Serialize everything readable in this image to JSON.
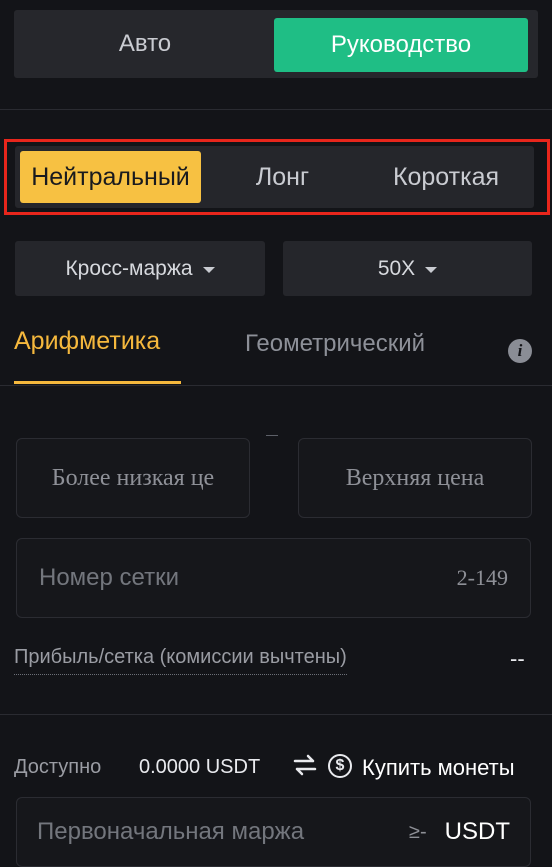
{
  "mode": {
    "auto": "Авто",
    "manual": "Руководство"
  },
  "direction": {
    "neutral": "Нейтральный",
    "long": "Лонг",
    "short": "Короткая"
  },
  "margin_mode": {
    "label": "Кросс-маржа"
  },
  "leverage": {
    "label": "50X"
  },
  "tabs": {
    "arithmetic": "Арифметика",
    "geometric": "Геометрический",
    "info_icon": "i"
  },
  "price": {
    "lower_placeholder": "Более низкая це",
    "upper_placeholder": "Верхняя цена"
  },
  "grid": {
    "placeholder": "Номер сетки",
    "range": "2-149"
  },
  "profit": {
    "label": "Прибыль/сетка (комиссии вычтены)",
    "value": "--"
  },
  "available": {
    "label": "Доступно",
    "value": "0.0000 USDT",
    "buy_coins": "Купить монеты"
  },
  "initial_margin": {
    "placeholder": "Первоначальная маржа",
    "min_prefix": "≥-",
    "unit": "USDT"
  },
  "colors": {
    "accent_green": "#1fbe85",
    "accent_yellow": "#f7c142",
    "highlight_red": "#e8261c",
    "tab_active": "#f5b83d"
  }
}
